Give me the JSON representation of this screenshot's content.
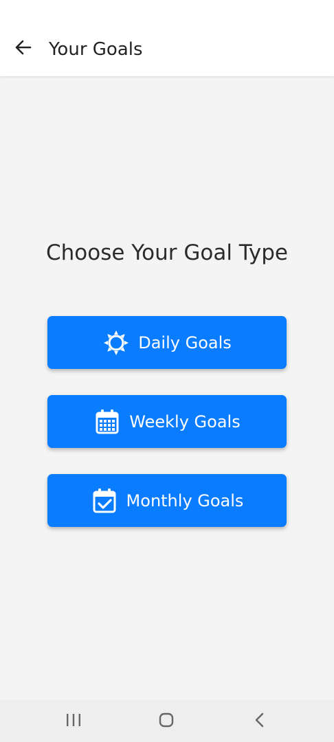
{
  "header": {
    "title": "Your Goals",
    "back_icon": "arrow-left-icon"
  },
  "main": {
    "heading": "Choose Your Goal Type",
    "buttons": [
      {
        "label": "Daily Goals",
        "icon": "sun-icon"
      },
      {
        "label": "Weekly Goals",
        "icon": "calendar-grid-icon"
      },
      {
        "label": "Monthly Goals",
        "icon": "calendar-check-icon"
      }
    ]
  },
  "nav_bar": {
    "recent_icon": "recent-apps-icon",
    "home_icon": "home-icon",
    "back_icon": "nav-back-icon"
  },
  "colors": {
    "accent": "#0a7cff",
    "background": "#f4f4f4",
    "header_bg": "#ffffff",
    "nav_bg": "#eeeeee",
    "text_dark": "#222222"
  }
}
